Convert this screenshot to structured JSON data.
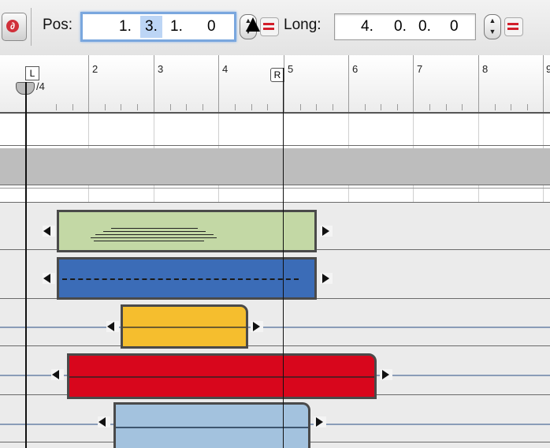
{
  "toolbar": {
    "icon": "record-icon",
    "pos_label": "Pos:",
    "pos_segments": [
      "1.",
      "3.",
      "1.",
      "0"
    ],
    "long_label": "Long:",
    "long_segments": [
      "4.",
      "0.",
      "0.",
      "0"
    ]
  },
  "ruler": {
    "signature": "/4",
    "left_locator": "L",
    "right_locator": "R",
    "bars": [
      "2",
      "3",
      "4",
      "5",
      "6",
      "7",
      "8",
      "9"
    ]
  },
  "colors": {
    "green_region": "#c3d8a5",
    "blue_region": "#3b6cb7",
    "yellow_region": "#f5be2e",
    "red_region": "#d8061c",
    "lightblue_region": "#a3c2de",
    "focus_ring": "#7aa7de",
    "equals_icon": "#d21f2b"
  }
}
